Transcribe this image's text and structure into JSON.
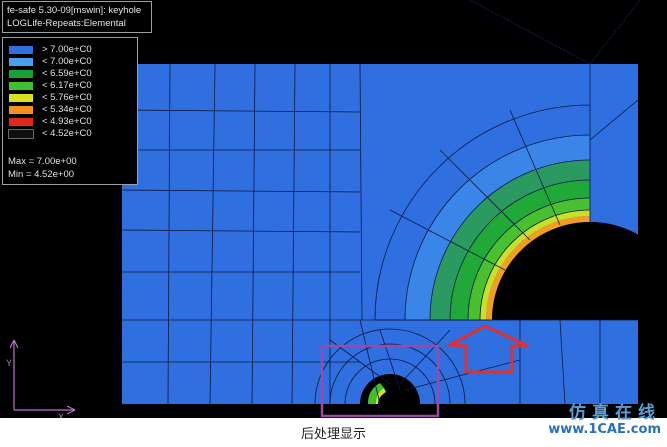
{
  "header": {
    "line1": "fe-safe 5.30-09[mswin]: keyhole",
    "line2": "LOGLife-Repeats:Elemental"
  },
  "legend": {
    "entries": [
      {
        "label": "> 7.00e+C0",
        "color": "#2f6fe0"
      },
      {
        "label": "< 7.00e+C0",
        "color": "#4aa0f0"
      },
      {
        "label": "< 6.59e+C0",
        "color": "#18a038"
      },
      {
        "label": "< 6.17e+C0",
        "color": "#40c030"
      },
      {
        "label": "< 5.76e+C0",
        "color": "#d8e020"
      },
      {
        "label": "< 5.34e+C0",
        "color": "#f09020"
      },
      {
        "label": "< 4.93e+C0",
        "color": "#e02818"
      },
      {
        "label": "< 4.52e+C0",
        "color": "#101010"
      }
    ],
    "max_label": "Max = 7.00e+00",
    "min_label": "Min = 4.52e+00"
  },
  "axes": {
    "y_label": "Y",
    "x_label": "X"
  },
  "colors": {
    "model_base": "#2f6fe0",
    "mesh_line": "#0a1a40",
    "highlight_box": "#9a4aa8",
    "arrow": "#e03030",
    "triad": "#c070d0"
  },
  "caption": "后处理显示",
  "watermark": {
    "top": "仿真在线",
    "bottom": "www.1CAE.com"
  }
}
